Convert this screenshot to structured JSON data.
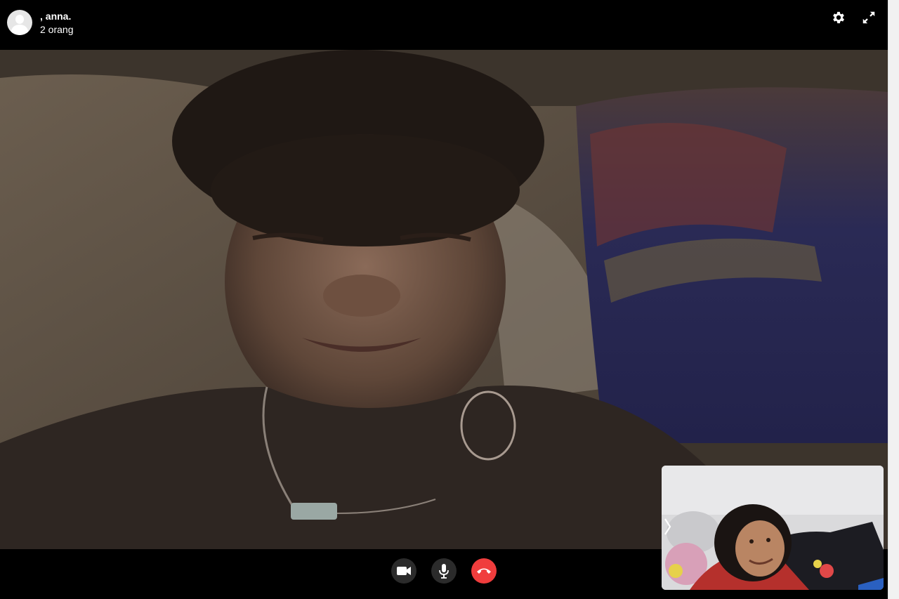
{
  "header": {
    "caller_name": ", anna.",
    "participants": "2 orang",
    "avatar_icon": "user-avatar-icon",
    "settings_icon": "gear-icon",
    "fullscreen_icon": "expand-icon"
  },
  "controls": {
    "camera_icon": "video-camera-icon",
    "mic_icon": "microphone-icon",
    "end_call_icon": "phone-hangup-icon",
    "end_call_color": "#f03d3d"
  },
  "self_view": {
    "toggle_icon": "chevron-right-icon"
  }
}
